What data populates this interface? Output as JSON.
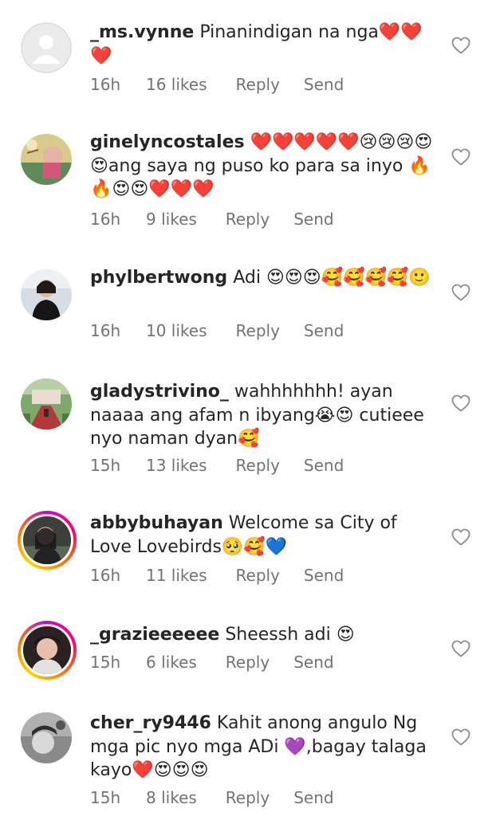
{
  "comments": [
    {
      "username": "_ms.vynne",
      "text": "Pinanindigan na nga❤️❤️❤️",
      "time": "16h",
      "likes": "16 likes",
      "reply": "Reply",
      "send": "Send",
      "avatar": "default-avatar-icon"
    },
    {
      "username": "ginelyncostales",
      "text": "❤️❤️❤️❤️❤️😢😢😢😍😍ang saya ng puso ko para sa inyo 🔥🔥😍😍❤️❤️❤️",
      "time": "16h",
      "likes": "9 likes",
      "reply": "Reply",
      "send": "Send",
      "avatar": "photo-avatar"
    },
    {
      "username": "phylbertwong",
      "text": "Adi 😍😍😍🥰🥰🥰🥰🙂",
      "time": "16h",
      "likes": "10 likes",
      "reply": "Reply",
      "send": "Send",
      "avatar": "photo-avatar"
    },
    {
      "username": "gladystrivino_",
      "text": "wahhhhhhh! ayan naaaa ang afam n ibyang😭😍 cutieee nyo naman dyan🥰",
      "time": "15h",
      "likes": "13 likes",
      "reply": "Reply",
      "send": "Send",
      "avatar": "photo-avatar"
    },
    {
      "username": "abbybuhayan",
      "text": "Welcome sa City of Love Lovebirds🥺🥰💙",
      "time": "16h",
      "likes": "11 likes",
      "reply": "Reply",
      "send": "Send",
      "avatar": "story-ring-avatar"
    },
    {
      "username": "_grazieeeeee",
      "text": "Sheessh adi 😍",
      "time": "15h",
      "likes": "6 likes",
      "reply": "Reply",
      "send": "Send",
      "avatar": "story-ring-avatar"
    },
    {
      "username": "cher_ry9446",
      "text": "Kahit anong angulo Ng mga pic nyo mga ADi 💜,bagay talaga kayo❤️😍😍😍",
      "time": "15h",
      "likes": "8 likes",
      "reply": "Reply",
      "send": "Send",
      "avatar": "photo-avatar"
    }
  ],
  "icons": {
    "like": "heart-outline-icon"
  },
  "colors": {
    "text": "#262626",
    "meta": "#737373",
    "heart": "#8e8e8e",
    "ring_start": "#d300c5",
    "ring_end": "#ffd600"
  }
}
